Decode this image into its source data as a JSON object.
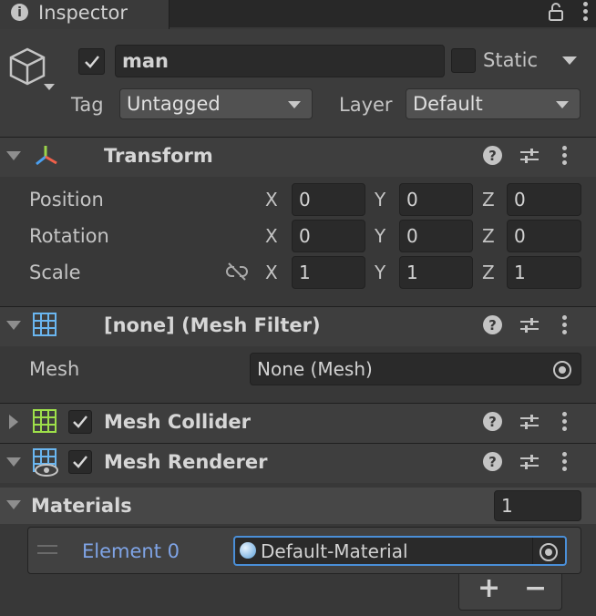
{
  "tab": {
    "title": "Inspector"
  },
  "gameobject": {
    "name": "man",
    "active": true,
    "static_label": "Static",
    "static_checked": false,
    "tag_label": "Tag",
    "tag_value": "Untagged",
    "layer_label": "Layer",
    "layer_value": "Default"
  },
  "transform": {
    "title": "Transform",
    "rows": [
      {
        "label": "Position",
        "x": "0",
        "y": "0",
        "z": "0"
      },
      {
        "label": "Rotation",
        "x": "0",
        "y": "0",
        "z": "0"
      },
      {
        "label": "Scale",
        "x": "1",
        "y": "1",
        "z": "1"
      }
    ],
    "axis_x": "X",
    "axis_y": "Y",
    "axis_z": "Z"
  },
  "mesh_filter": {
    "title": "[none] (Mesh Filter)",
    "mesh_label": "Mesh",
    "mesh_value": "None (Mesh)"
  },
  "mesh_collider": {
    "title": "Mesh Collider",
    "enabled": true
  },
  "mesh_renderer": {
    "title": "Mesh Renderer",
    "enabled": true
  },
  "materials": {
    "title": "Materials",
    "count": "1",
    "element_label": "Element 0",
    "element_value": "Default-Material",
    "add": "+",
    "remove": "−"
  },
  "icons": {
    "help": "?"
  },
  "colors": {
    "background": "#383838",
    "field": "#2a2a2a",
    "accent_blue": "#4a8fd8",
    "element_label": "#7fa4e6"
  }
}
